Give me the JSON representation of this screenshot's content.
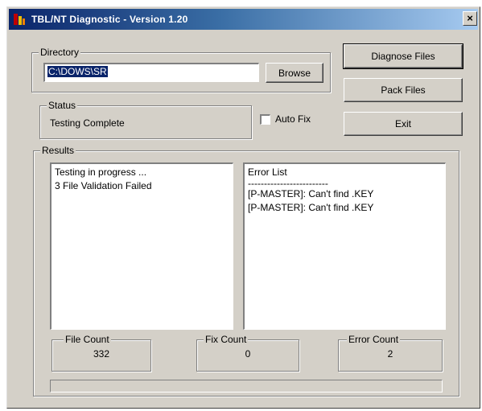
{
  "window": {
    "title": "TBL/NT Diagnostic - Version 1.20",
    "close_glyph": "×"
  },
  "directory": {
    "legend": "Directory",
    "path_value": "C:\\DOWS\\SR",
    "browse_label": "Browse"
  },
  "status": {
    "legend": "Status",
    "text": "Testing Complete"
  },
  "autofix": {
    "label": "Auto Fix",
    "checked": false
  },
  "buttons": {
    "diagnose": "Diagnose Files",
    "pack": "Pack Files",
    "exit": "Exit"
  },
  "results": {
    "legend": "Results",
    "progress_lines": [
      "Testing in progress ...",
      "3 File Validation Failed"
    ],
    "error_lines": [
      "Error List",
      "-------------------------",
      "[P-MASTER]: Can't find .KEY",
      "[P-MASTER]: Can't find .KEY"
    ],
    "file_count_label": "File Count",
    "file_count_value": "332",
    "fix_count_label": "Fix Count",
    "fix_count_value": "0",
    "error_count_label": "Error Count",
    "error_count_value": "2",
    "progress_fraction": 0
  },
  "colors": {
    "face": "#d4d0c8",
    "title_start": "#0a246a",
    "title_end": "#a6caf0"
  }
}
